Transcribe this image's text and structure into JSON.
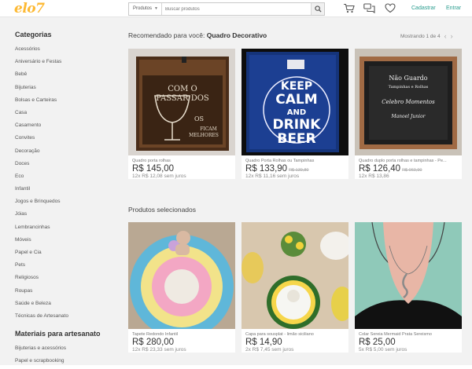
{
  "header": {
    "logo": "elo7",
    "search_category": "Produtos",
    "search_placeholder": "Buscar produtos",
    "cadastrar": "Cadastrar",
    "entrar": "Entrar",
    "icons": [
      "cart-icon",
      "chat-icon",
      "heart-icon",
      "search-icon"
    ]
  },
  "sidebar": {
    "categories_title": "Categorias",
    "categories": [
      "Acessórios",
      "Aniversário e Festas",
      "Bebê",
      "Bijuterias",
      "Bolsas e Carteiras",
      "Casa",
      "Casamento",
      "Convites",
      "Decoração",
      "Doces",
      "Eco",
      "Infantil",
      "Jogos e Brinquedos",
      "Jóias",
      "Lembrancinhas",
      "Móveis",
      "Papel e Cia",
      "Pets",
      "Religiosos",
      "Roupas",
      "Saúde e Beleza",
      "Técnicas de Artesanato"
    ],
    "materials_title": "Materiais para artesanato",
    "materials": [
      "Bijuterias e acessórios",
      "Papel e scrapbooking"
    ]
  },
  "recommended": {
    "label": "Recomendado para você:",
    "topic": "Quadro Decorativo",
    "pager": "Mostrando 1 de 4",
    "products": [
      {
        "name": "Quadro porta rolhas",
        "price": "R$ 145,00",
        "old_price": "",
        "installments": "12x R$ 12,08 sem juros"
      },
      {
        "name": "Quadro Porta Rolhas ou Tampinhas",
        "price": "R$ 133,90",
        "old_price": "R$ 139,80",
        "installments": "12x R$ 11,16 sem juros"
      },
      {
        "name": "Quadro duplo porta rolhas e tampinhas - Pe...",
        "price": "R$ 126,40",
        "old_price": "R$ 060,90",
        "installments": "12x R$ 13,86"
      }
    ]
  },
  "selected": {
    "title": "Produtos selecionados",
    "products": [
      {
        "name": "Tapete Redondo Infantil",
        "price": "R$ 280,00",
        "old_price": "",
        "installments": "12x R$ 23,33 sem juros"
      },
      {
        "name": "Capa para sousplat - limão siciliano",
        "price": "R$ 14,90",
        "old_price": "",
        "installments": "2x R$ 7,45 sem juros"
      },
      {
        "name": "Colar Sereia Mermaid Prata Sereismo",
        "price": "R$ 25,00",
        "old_price": "",
        "installments": "5x R$ 5,00 sem juros"
      }
    ]
  },
  "image_text": {
    "r1": [
      "COM O",
      "PASSAR DOS",
      "OS",
      "FICAM",
      "MELHORES"
    ],
    "r2": [
      "KEEP",
      "CALM",
      "AND",
      "DRINK",
      "BEER"
    ],
    "r3": [
      "Não Guardo",
      "Tampinhas e Rolhas",
      "Celebro Momentos",
      "Manoel Junior"
    ]
  },
  "colors": {
    "logo": "#fdb933",
    "link": "#2a9d8f",
    "background": "#f2f2f2"
  }
}
